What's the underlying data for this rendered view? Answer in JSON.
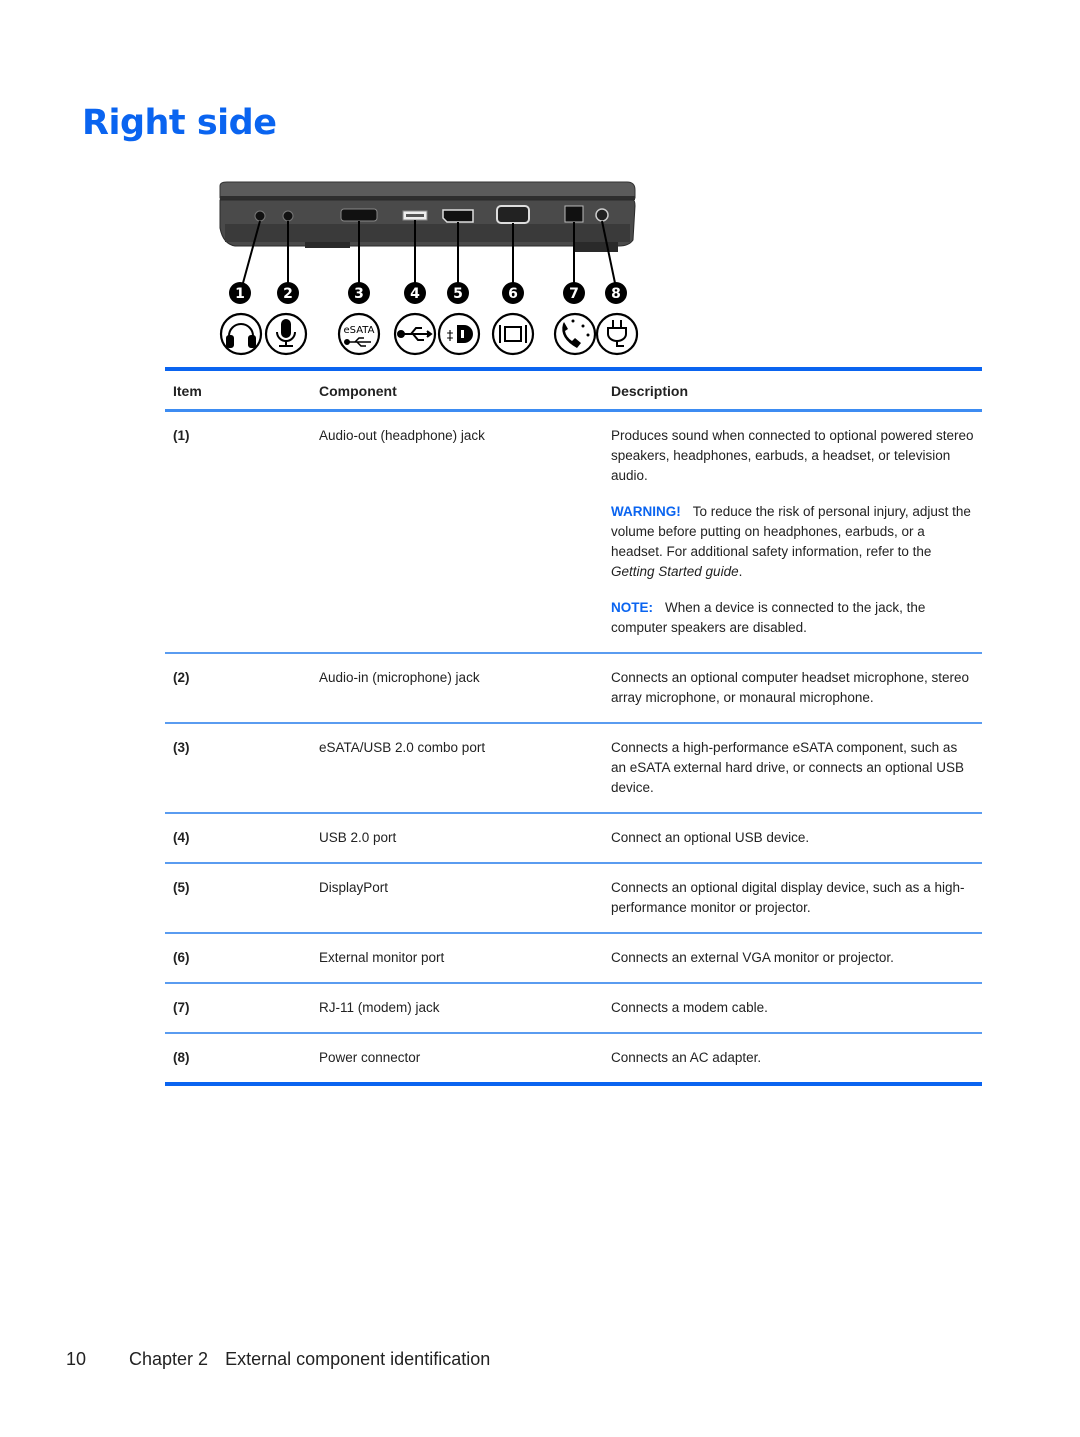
{
  "page": {
    "title": "Right side",
    "accent_color": "#0a64f0"
  },
  "figure": {
    "callouts": [
      "1",
      "2",
      "3",
      "4",
      "5",
      "6",
      "7",
      "8"
    ],
    "icons": [
      "headphone-icon",
      "microphone-icon",
      "esata-usb-icon",
      "usb-icon",
      "displayport-icon",
      "external-monitor-icon",
      "modem-icon",
      "power-plug-icon"
    ],
    "esata_label": "eSATA"
  },
  "table": {
    "headers": {
      "item": "Item",
      "component": "Component",
      "description": "Description"
    },
    "rows": [
      {
        "item": "(1)",
        "component": "Audio-out (headphone) jack",
        "description": "Produces sound when connected to optional powered stereo speakers, headphones, earbuds, a headset, or television audio.",
        "warning_label": "WARNING!",
        "warning_text_before": "To reduce the risk of personal injury, adjust the volume before putting on headphones, earbuds, or a headset. For additional safety information, refer to the ",
        "warning_italic": "Getting Started guide",
        "warning_text_after": ".",
        "note_label": "NOTE:",
        "note_text": "When a device is connected to the jack, the computer speakers are disabled."
      },
      {
        "item": "(2)",
        "component": "Audio-in (microphone) jack",
        "description": "Connects an optional computer headset microphone, stereo array microphone, or monaural microphone."
      },
      {
        "item": "(3)",
        "component": "eSATA/USB 2.0 combo port",
        "description": "Connects a high-performance eSATA component, such as an eSATA external hard drive, or connects an optional USB device."
      },
      {
        "item": "(4)",
        "component": "USB 2.0 port",
        "description": "Connect an optional USB device."
      },
      {
        "item": "(5)",
        "component": "DisplayPort",
        "description": "Connects an optional digital display device, such as a high-performance monitor or projector."
      },
      {
        "item": "(6)",
        "component": "External monitor port",
        "description": "Connects an external VGA monitor or projector."
      },
      {
        "item": "(7)",
        "component": "RJ-11 (modem) jack",
        "description": "Connects a modem cable."
      },
      {
        "item": "(8)",
        "component": "Power connector",
        "description": "Connects an AC adapter."
      }
    ]
  },
  "footer": {
    "page_number": "10",
    "chapter": "Chapter 2",
    "chapter_title": "External component identification"
  }
}
